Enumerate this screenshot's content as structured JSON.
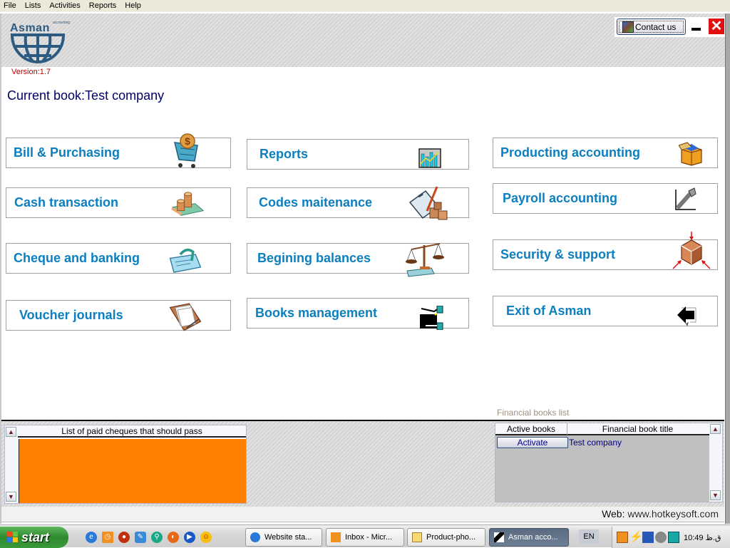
{
  "menu": [
    "File",
    "Lists",
    "Activities",
    "Reports",
    "Help"
  ],
  "header": {
    "logo_word": "Asman",
    "logo_tag": "accounting",
    "contact_label": "Contact us",
    "version": "Version:1.7"
  },
  "current_book": "Current book:Test company",
  "modules": [
    {
      "label": "Bill & Purchasing",
      "icon": "shopping-cart-dollar-icon"
    },
    {
      "label": "Cash transaction",
      "icon": "coins-cash-icon"
    },
    {
      "label": "Cheque and banking",
      "icon": "cheque-icon"
    },
    {
      "label": "Voucher journals",
      "icon": "folder-documents-icon"
    },
    {
      "label": "Reports",
      "icon": "bar-chart-icon"
    },
    {
      "label": "Codes maitenance",
      "icon": "clipboard-pencil-icon"
    },
    {
      "label": "Begining balances",
      "icon": "scales-icon"
    },
    {
      "label": "Books management",
      "icon": "hands-exchange-icon"
    },
    {
      "label": "Producting accounting",
      "icon": "open-box-icon"
    },
    {
      "label": "Payroll accounting",
      "icon": "wrench-icon"
    },
    {
      "label": "Security & support",
      "icon": "cube-arrows-icon"
    },
    {
      "label": "Exit of Asman",
      "icon": "back-arrow-icon"
    }
  ],
  "cheques_panel": {
    "header": "List of paid cheques that should pass"
  },
  "books_panel": {
    "caption": "Financial books list",
    "columns": [
      "Active books",
      "Financial book title"
    ],
    "rows": [
      {
        "action": "Activate",
        "title": "Test company"
      }
    ]
  },
  "footer": {
    "web_label": "Web:",
    "web_url": "www.hotkeysoft.com"
  },
  "taskbar": {
    "start": "start",
    "tasks": [
      {
        "label": "Website sta..."
      },
      {
        "label": "Inbox - Micr..."
      },
      {
        "label": "Product-pho..."
      },
      {
        "label": "Asman acco...",
        "active": true
      }
    ],
    "language": "EN",
    "clock": "10:49 ق.ظ"
  }
}
